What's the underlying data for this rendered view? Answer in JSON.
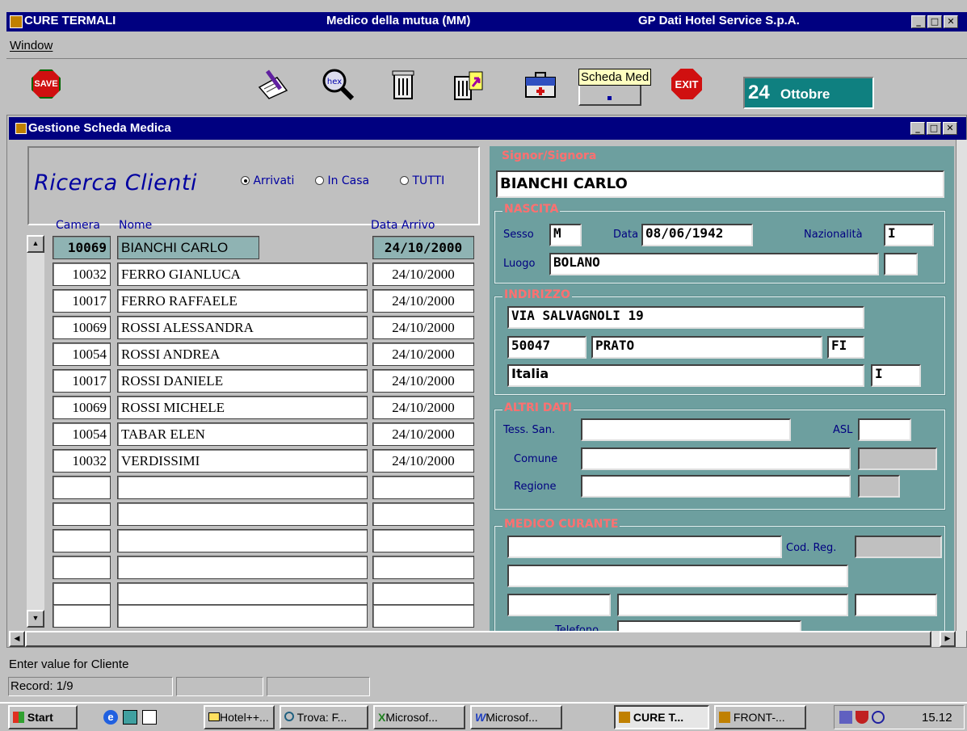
{
  "app": {
    "title": "CURE TERMALI",
    "subtitle": "Medico della mutua (MM)",
    "company": "GP Dati Hotel Service S.p.A."
  },
  "menu": {
    "window": "Window"
  },
  "toolbar": {
    "save": "SAVE",
    "hex": "hex",
    "exit": "EXIT",
    "scheda_med": "Scheda Med",
    "date_day": "24",
    "date_month": "Ottobre"
  },
  "subwindow": {
    "title": "Gestione Scheda Medica"
  },
  "search": {
    "title": "Ricerca Clienti",
    "options": [
      "Arrivati",
      "In Casa",
      "TUTTI"
    ],
    "selected": "Arrivati"
  },
  "table": {
    "columns": [
      "Camera",
      "Nome",
      "Data Arrivo"
    ],
    "rows": [
      {
        "camera": "10069",
        "nome": "BIANCHI CARLO",
        "data": "24/10/2000"
      },
      {
        "camera": "10032",
        "nome": "FERRO GIANLUCA",
        "data": "24/10/2000"
      },
      {
        "camera": "10017",
        "nome": "FERRO RAFFAELE",
        "data": "24/10/2000"
      },
      {
        "camera": "10069",
        "nome": "ROSSI ALESSANDRA",
        "data": "24/10/2000"
      },
      {
        "camera": "10054",
        "nome": "ROSSI ANDREA",
        "data": "24/10/2000"
      },
      {
        "camera": "10017",
        "nome": "ROSSI DANIELE",
        "data": "24/10/2000"
      },
      {
        "camera": "10069",
        "nome": "ROSSI MICHELE",
        "data": "24/10/2000"
      },
      {
        "camera": "10054",
        "nome": "TABAR ELEN",
        "data": "24/10/2000"
      },
      {
        "camera": "10032",
        "nome": "VERDISSIMI",
        "data": "24/10/2000"
      }
    ]
  },
  "detail": {
    "signor_label": "Signor/Signora",
    "nome": "BIANCHI CARLO",
    "nascita": {
      "title": "NASCITA",
      "sesso_label": "Sesso",
      "sesso": "M",
      "data_label": "Data",
      "data": "08/06/1942",
      "naz_label": "Nazionalità",
      "naz": "I",
      "luogo_label": "Luogo",
      "luogo": "BOLANO"
    },
    "indirizzo": {
      "title": "INDIRIZZO",
      "via": "VIA SALVAGNOLI  19",
      "cap": "50047",
      "citta": "PRATO",
      "prov": "FI",
      "paese": "Italia",
      "paese_code": "I"
    },
    "altri": {
      "title": "ALTRI DATI",
      "tess_label": "Tess. San.",
      "asl_label": "ASL",
      "comune_label": "Comune",
      "regione_label": "Regione"
    },
    "medico": {
      "title": "MEDICO CURANTE",
      "codreg_label": "Cod. Reg.",
      "telefono_label": "Telefono"
    }
  },
  "status": {
    "message": "Enter value for Cliente",
    "record": "Record: 1/9"
  },
  "taskbar": {
    "start": "Start",
    "items": [
      "Hotel++...",
      "Trova: F...",
      "Microsof...",
      "Microsof...",
      "CURE T...",
      "FRONT-..."
    ],
    "clock": "15.12"
  },
  "colors": {
    "titlebar": "#000080",
    "panel": "#6d9f9f",
    "group_title": "#ff7070",
    "date_box": "#0f8080"
  }
}
